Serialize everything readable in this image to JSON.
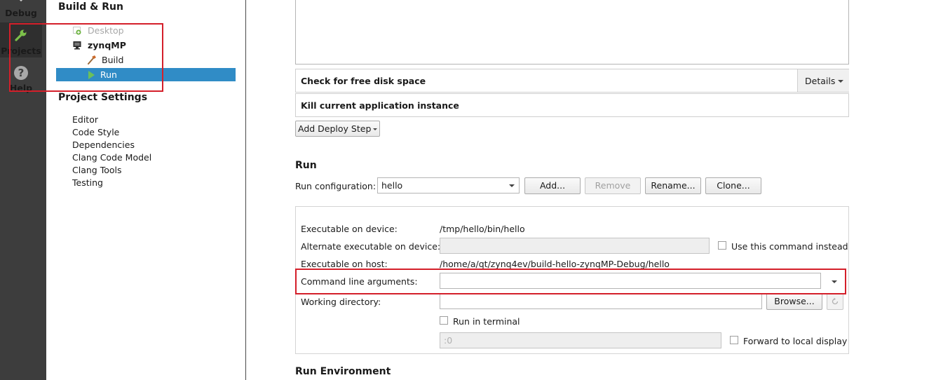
{
  "modebar": {
    "debug_label": "Debug",
    "projects_label": "Projects",
    "help_label": "Help",
    "help_glyph": "?"
  },
  "left": {
    "build_run_title": "Build & Run",
    "tree": {
      "desktop": "Desktop",
      "kit": "zynqMP",
      "build": "Build",
      "run": "Run"
    },
    "project_settings_title": "Project Settings",
    "settings_items": [
      "Editor",
      "Code Style",
      "Dependencies",
      "Clang Code Model",
      "Clang Tools",
      "Testing"
    ]
  },
  "deploy": {
    "check_disk_label": "Check for free disk space",
    "details_button": "Details",
    "kill_instance_label": "Kill current application instance",
    "add_deploy_step_button": "Add Deploy Step"
  },
  "run": {
    "section_title": "Run",
    "run_config_label": "Run configuration:",
    "run_config_value": "hello",
    "add_button": "Add...",
    "remove_button": "Remove",
    "rename_button": "Rename...",
    "clone_button": "Clone...",
    "exec_device_label": "Executable on device:",
    "exec_device_value": "/tmp/hello/bin/hello",
    "alt_exec_label": "Alternate executable on device:",
    "use_command_label": "Use this command instead",
    "exec_host_label": "Executable on host:",
    "exec_host_value": "/home/a/qt/zynq4ev/build-hello-zynqMP-Debug/hello",
    "cmd_args_label": "Command line arguments:",
    "cmd_args_value": "",
    "working_dir_label": "Working directory:",
    "working_dir_value": "",
    "browse_button": "Browse...",
    "run_in_terminal_label": "Run in terminal",
    "display_placeholder": ":0",
    "forward_display_label": "Forward to local display"
  },
  "run_env_title": "Run Environment",
  "colors": {
    "selection": "#308cc6",
    "highlight_box": "#d41f2a",
    "modebar": "#3d3d3d"
  }
}
